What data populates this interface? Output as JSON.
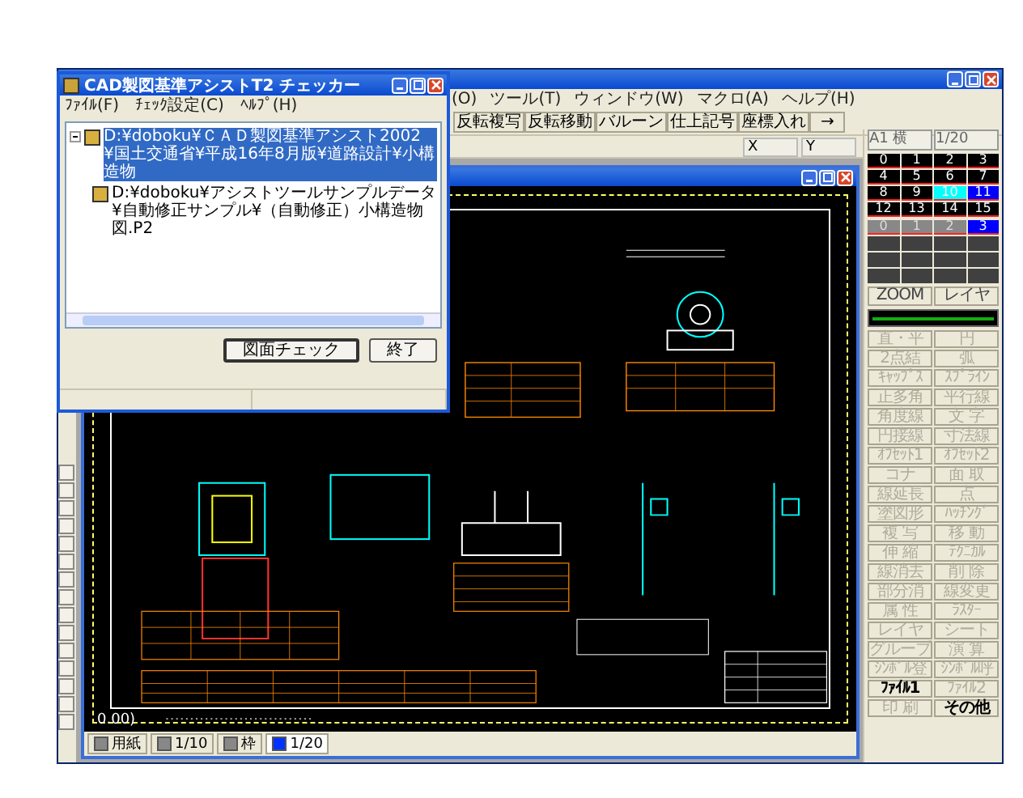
{
  "checker_dialog": {
    "title": "CAD製図基準アシストT2 チェッカー",
    "menu": [
      "ﾌｧｲﾙ(F)",
      "ﾁｪｯｸ設定(C)",
      "ﾍﾙﾌﾟ(H)"
    ],
    "tree": [
      {
        "label": "D:¥doboku¥ＣＡＤ製図基準アシスト2002¥国土交通省¥平成16年8月版¥道路設計¥小構造物",
        "selected": true,
        "expanded": true,
        "children": [
          {
            "label": "D:¥doboku¥アシストツールサンプルデータ¥自動修正サンプル¥（自動修正）小構造物図.P2",
            "selected": false
          }
        ]
      }
    ],
    "buttons": [
      "図面チェック",
      "終了"
    ]
  },
  "main_window": {
    "menu": [
      "(O)",
      "ツール(T)",
      "ウィンドウ(W)",
      "マクロ(A)",
      "ヘルプ(H)"
    ],
    "toolbar": [
      "反転複写",
      "反転移動",
      "バルーン",
      "仕上記号",
      "座標入れ",
      "→"
    ],
    "coordinates": [
      "X",
      "Y"
    ],
    "sheet": {
      "size": "A1 横",
      "scale": "1/20"
    },
    "colors": [
      {
        "label": "0",
        "color": "#000000"
      },
      {
        "label": "1",
        "color": "#000000"
      },
      {
        "label": "2",
        "color": "#000000"
      },
      {
        "label": "3",
        "color": "#000000"
      },
      {
        "label": "4",
        "color": "#000000"
      },
      {
        "label": "5",
        "color": "#000000"
      },
      {
        "label": "6",
        "color": "#000000"
      },
      {
        "label": "7",
        "color": "#000000"
      },
      {
        "label": "8",
        "color": "#000000"
      },
      {
        "label": "9",
        "color": "#000000"
      },
      {
        "label": "10",
        "color": "#00ffff"
      },
      {
        "label": "11",
        "color": "#0000ff"
      },
      {
        "label": "12",
        "color": "#000000"
      },
      {
        "label": "13",
        "color": "#000000"
      },
      {
        "label": "14",
        "color": "#000000"
      },
      {
        "label": "15",
        "color": "#000000"
      }
    ],
    "layers": [
      {
        "label": "0",
        "selected": false
      },
      {
        "label": "1",
        "selected": false
      },
      {
        "label": "2",
        "selected": false
      },
      {
        "label": "3",
        "selected": true
      }
    ],
    "view_buttons": [
      "ZOOM",
      "レイヤ"
    ],
    "commands": [
      {
        "label": "直・平",
        "disabled": true
      },
      {
        "label": "円",
        "disabled": true
      },
      {
        "label": "2点結",
        "disabled": true
      },
      {
        "label": "弧",
        "disabled": true
      },
      {
        "label": "ｷｬｯﾌﾟｽ",
        "disabled": true
      },
      {
        "label": "ｽﾌﾟﾗｲﾝ",
        "disabled": true
      },
      {
        "label": "正多角",
        "disabled": true
      },
      {
        "label": "平行線",
        "disabled": true
      },
      {
        "label": "角度線",
        "disabled": true
      },
      {
        "label": "文 字",
        "disabled": true
      },
      {
        "label": "円接線",
        "disabled": true
      },
      {
        "label": "寸法線",
        "disabled": true
      },
      {
        "label": "ｵﾌｾｯﾄ1",
        "disabled": true
      },
      {
        "label": "ｵﾌｾｯﾄ2",
        "disabled": true
      },
      {
        "label": "コナ",
        "disabled": true
      },
      {
        "label": "面 取",
        "disabled": true
      },
      {
        "label": "線延長",
        "disabled": true
      },
      {
        "label": "点",
        "disabled": true
      },
      {
        "label": "塗図形",
        "disabled": true
      },
      {
        "label": "ﾊｯﾁﾝｸﾞ",
        "disabled": true
      },
      {
        "label": "複 写",
        "disabled": true
      },
      {
        "label": "移 動",
        "disabled": true
      },
      {
        "label": "伸 縮",
        "disabled": true
      },
      {
        "label": "ﾃｸﾆｶﾙ",
        "disabled": true
      },
      {
        "label": "線消去",
        "disabled": true
      },
      {
        "label": "削 除",
        "disabled": true
      },
      {
        "label": "部分消",
        "disabled": true
      },
      {
        "label": "線変更",
        "disabled": true
      },
      {
        "label": "属 性",
        "disabled": true
      },
      {
        "label": "ﾗｽﾀｰ",
        "disabled": true
      },
      {
        "label": "レイヤ",
        "disabled": true
      },
      {
        "label": "シート",
        "disabled": true
      },
      {
        "label": "グループ",
        "disabled": true
      },
      {
        "label": "演 算",
        "disabled": true
      },
      {
        "label": "ｼﾝﾎﾞﾙ登",
        "disabled": true
      },
      {
        "label": "ｼﾝﾎﾞﾙ呼",
        "disabled": true
      },
      {
        "label": "ﾌｧｲﾙ1",
        "disabled": false
      },
      {
        "label": "ﾌｧｲﾙ2",
        "disabled": true
      },
      {
        "label": "印 刷",
        "disabled": true
      },
      {
        "label": "その他",
        "disabled": false
      }
    ],
    "drawing_window": {
      "cursor_label": "0.00)",
      "status": [
        {
          "label": "用紙",
          "selected": false
        },
        {
          "label": "1/10",
          "selected": false
        },
        {
          "label": "枠",
          "selected": false
        },
        {
          "label": "1/20",
          "selected": true
        }
      ]
    }
  }
}
